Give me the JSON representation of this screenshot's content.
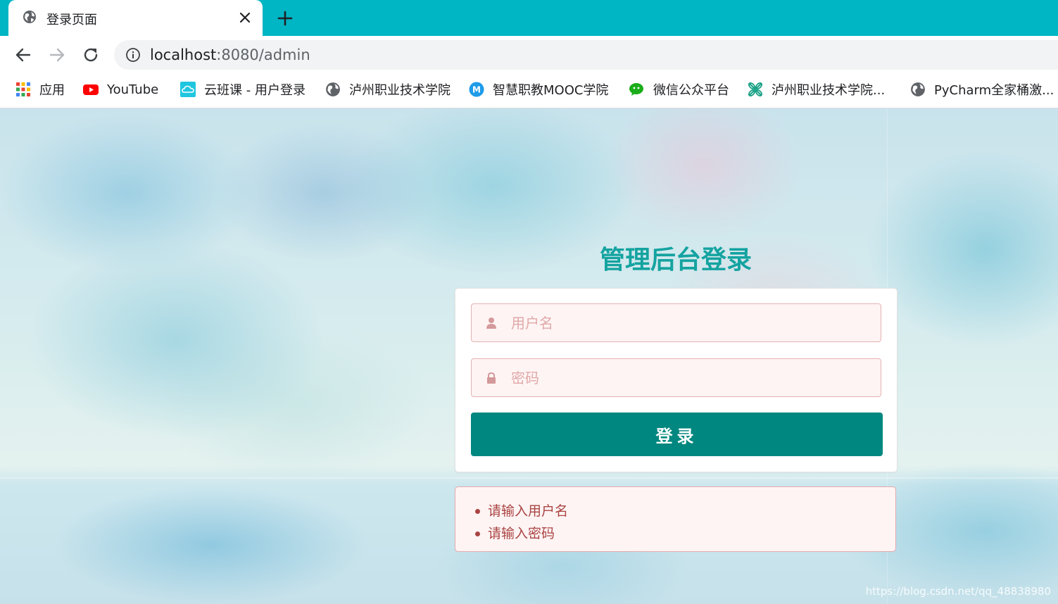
{
  "browser": {
    "tab_title": "登录页面",
    "url_host": "localhost",
    "url_rest": ":8080/admin",
    "accent_color": "#00b5c4"
  },
  "bookmarks": [
    {
      "label": "应用",
      "icon": "apps-grid-icon"
    },
    {
      "label": "YouTube",
      "icon": "youtube-icon"
    },
    {
      "label": "云班课 - 用户登录",
      "icon": "cloud-icon"
    },
    {
      "label": "泸州职业技术学院",
      "icon": "globe-icon"
    },
    {
      "label": "智慧职教MOOC学院",
      "icon": "mooc-icon"
    },
    {
      "label": "微信公众平台",
      "icon": "wechat-icon"
    },
    {
      "label": "泸州职业技术学院...",
      "icon": "knot-icon"
    },
    {
      "label": "PyCharm全家桶激...",
      "icon": "globe-icon"
    }
  ],
  "login": {
    "title": "管理后台登录",
    "username_placeholder": "用户名",
    "password_placeholder": "密码",
    "username_value": "",
    "password_value": "",
    "submit_label": "登录",
    "title_color": "#14a3a0",
    "button_color": "#00877f"
  },
  "errors": [
    "请输入用户名",
    "请输入密码"
  ],
  "watermark": "https://blog.csdn.net/qq_48838980"
}
